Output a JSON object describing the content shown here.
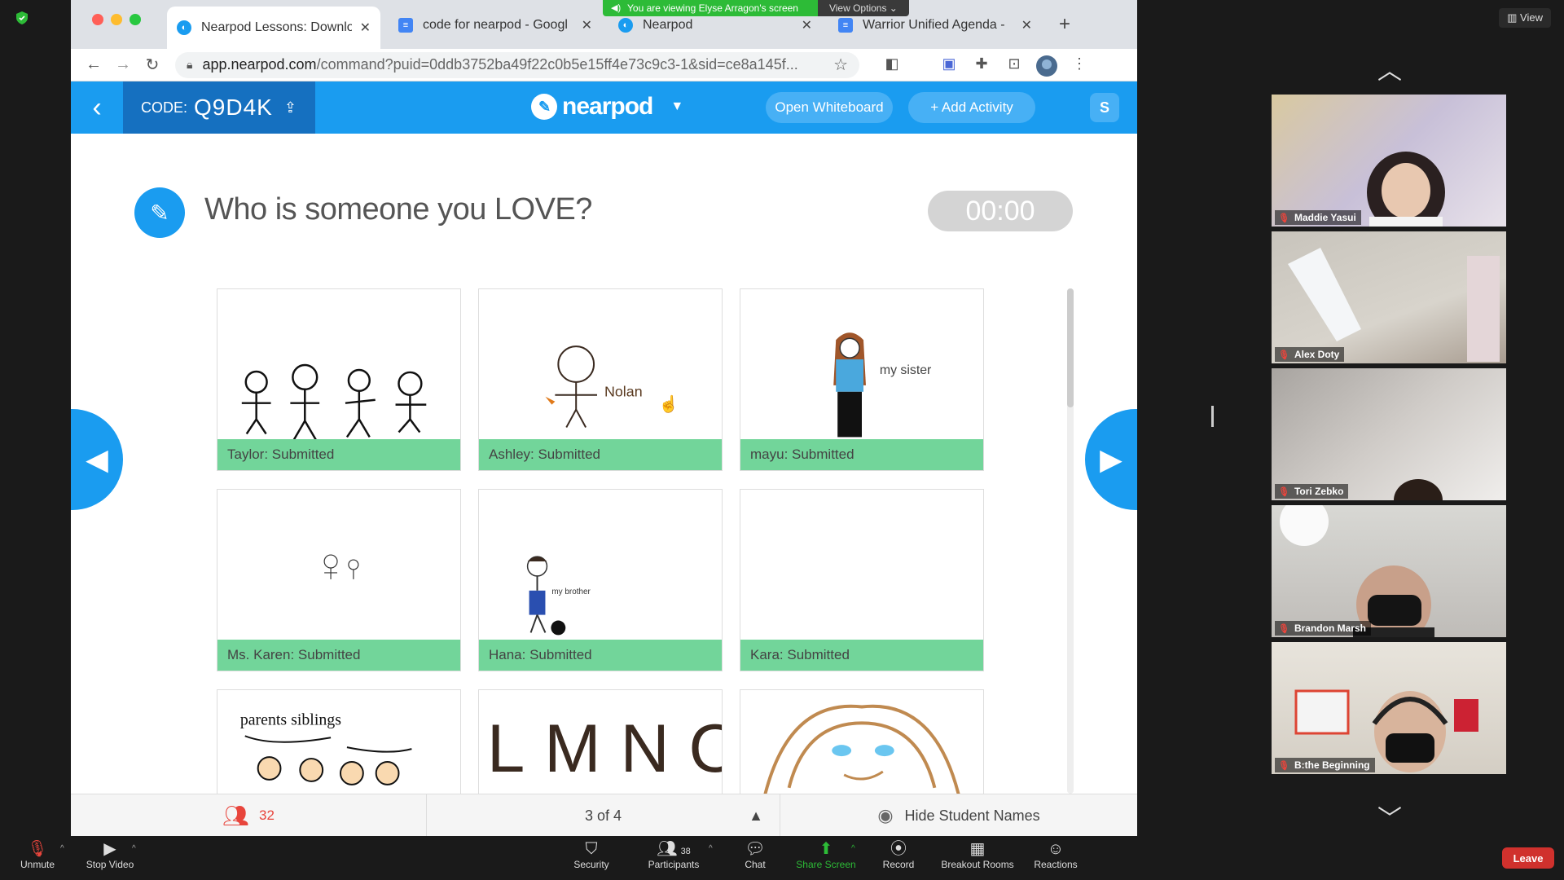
{
  "zoom": {
    "share_banner": "You are viewing Elyse Arragon's screen",
    "view_options": "View Options",
    "view_button": "View",
    "participants_count": "38",
    "toolbar": {
      "unmute": "Unmute",
      "stop_video": "Stop Video",
      "security": "Security",
      "participants": "Participants",
      "chat": "Chat",
      "share_screen": "Share Screen",
      "record": "Record",
      "breakout_rooms": "Breakout Rooms",
      "reactions": "Reactions",
      "leave": "Leave"
    },
    "gallery": [
      {
        "name": "Maddie Yasui"
      },
      {
        "name": "Alex Doty"
      },
      {
        "name": "Tori Zebko"
      },
      {
        "name": "Brandon Marsh"
      },
      {
        "name": "B:the Beginning"
      }
    ]
  },
  "browser": {
    "tabs": [
      {
        "title": "Nearpod Lessons: Downlo",
        "icon": "nearpod-icon"
      },
      {
        "title": "code for nearpod - Googl",
        "icon": "docs-icon"
      },
      {
        "title": "Nearpod",
        "icon": "nearpod-icon"
      },
      {
        "title": "Warrior Unified Agenda -",
        "icon": "docs-icon"
      }
    ],
    "url_host": "app.nearpod.com",
    "url_path": "/command?puid=0ddb3752ba49f22c0b5e15ff4e73c9c3-1&sid=ce8a145f..."
  },
  "nearpod": {
    "code_label": "CODE:",
    "code_value": "Q9D4K",
    "logo": "nearpod",
    "open_whiteboard": "Open Whiteboard",
    "add_activity": "+ Add Activity",
    "s_badge": "S",
    "question": "Who is someone you LOVE?",
    "timer": "00:00",
    "submissions": [
      {
        "label": "Taylor: Submitted"
      },
      {
        "label": "Ashley: Submitted",
        "drawing_text": "Nolan"
      },
      {
        "label": "mayu: Submitted",
        "drawing_text": "my sister"
      },
      {
        "label": "Ms. Karen: Submitted"
      },
      {
        "label": "Hana: Submitted",
        "drawing_text": "my brother"
      },
      {
        "label": "Kara: Submitted"
      },
      {
        "label": "",
        "drawing_text": "parents siblings"
      },
      {
        "label": "",
        "drawing_text": "LMNO"
      },
      {
        "label": ""
      }
    ],
    "footer": {
      "student_count": "32",
      "page": "3 of 4",
      "hide_names": "Hide Student Names"
    }
  }
}
